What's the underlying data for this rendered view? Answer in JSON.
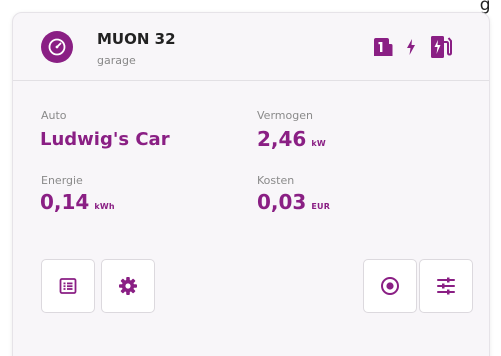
{
  "corner_text": "g",
  "charger": {
    "name": "MUON 32",
    "location": "garage"
  },
  "status_icons": [
    "car-plug-icon",
    "bolt-icon",
    "charging-station-icon"
  ],
  "metrics": {
    "car": {
      "label": "Auto",
      "value": "Ludwig's Car"
    },
    "power": {
      "label": "Vermogen",
      "value": "2,46",
      "unit": "kW"
    },
    "energy": {
      "label": "Energie",
      "value": "0,14",
      "unit": "kWh"
    },
    "cost": {
      "label": "Kosten",
      "value": "0,03",
      "unit": "EUR"
    }
  },
  "buttons": [
    "list-icon",
    "gear-icon",
    "stop-icon",
    "sliders-icon"
  ],
  "colors": {
    "accent": "#8a1f84",
    "card_background": "#f8f6f9",
    "label": "#8a8a8a"
  }
}
